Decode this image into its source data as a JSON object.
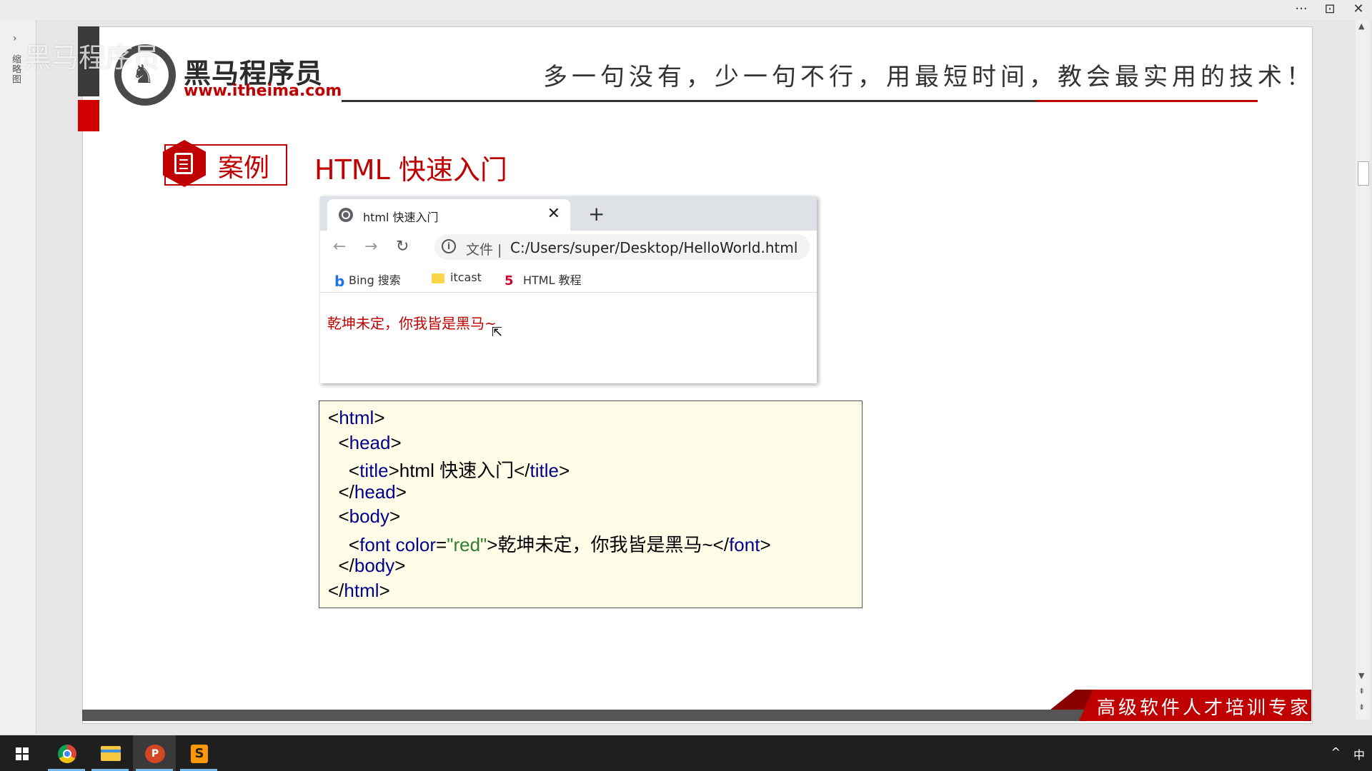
{
  "window": {
    "controls": [
      "···",
      "⊡",
      "✕"
    ]
  },
  "left_pane": {
    "chevron": "›",
    "label": "缩略图"
  },
  "watermark": "黑马程序员",
  "logo": {
    "name_cn": "黑马程序员",
    "url": "www.itheima.com"
  },
  "slogan": "多一句没有，少一句不行，用最短时间，教会最实用的技术！",
  "case": {
    "badge": "案例",
    "title": "HTML 快速入门"
  },
  "browser": {
    "tab_title": "html 快速入门",
    "tab_close": "✕",
    "new_tab": "+",
    "nav": {
      "back": "←",
      "forward": "→",
      "reload": "↻"
    },
    "security_label": "文件 |",
    "url": "C:/Users/super/Desktop/HelloWorld.html",
    "bookmarks": [
      "Bing 搜索",
      "itcast",
      "HTML 教程"
    ],
    "page_text": "乾坤未定，你我皆是黑马~"
  },
  "code": {
    "lines": [
      {
        "indent": "",
        "parts": [
          {
            "t": "<"
          },
          {
            "t": "html",
            "k": "kw"
          },
          {
            "t": ">"
          }
        ]
      },
      {
        "indent": "  ",
        "parts": [
          {
            "t": "<"
          },
          {
            "t": "head",
            "k": "kw"
          },
          {
            "t": ">"
          }
        ]
      },
      {
        "indent": "    ",
        "parts": [
          {
            "t": "<"
          },
          {
            "t": "title",
            "k": "kw"
          },
          {
            "t": ">html 快速入门</"
          },
          {
            "t": "title",
            "k": "kw"
          },
          {
            "t": ">"
          }
        ]
      },
      {
        "indent": "  ",
        "parts": [
          {
            "t": "</"
          },
          {
            "t": "head",
            "k": "kw"
          },
          {
            "t": ">"
          }
        ]
      },
      {
        "indent": "  ",
        "parts": [
          {
            "t": "<"
          },
          {
            "t": "body",
            "k": "kw"
          },
          {
            "t": ">"
          }
        ]
      },
      {
        "indent": "    ",
        "parts": [
          {
            "t": "<"
          },
          {
            "t": "font color",
            "k": "kw"
          },
          {
            "t": "="
          },
          {
            "t": "\"red\"",
            "k": "str"
          },
          {
            "t": ">乾坤未定，你我皆是黑马~</"
          },
          {
            "t": "font",
            "k": "kw"
          },
          {
            "t": ">"
          }
        ]
      },
      {
        "indent": "  ",
        "parts": [
          {
            "t": "</"
          },
          {
            "t": "body",
            "k": "kw"
          },
          {
            "t": ">"
          }
        ]
      },
      {
        "indent": "",
        "parts": [
          {
            "t": "</"
          },
          {
            "t": "html",
            "k": "kw"
          },
          {
            "t": ">"
          }
        ]
      }
    ]
  },
  "footer": "高级软件人才培训专家",
  "taskbar": {
    "tray": [
      "^",
      "中"
    ]
  },
  "colors": {
    "brand_red": "#c00000",
    "code_bg": "#fffde8",
    "keyword": "#00008b",
    "string": "#2e7d32"
  }
}
